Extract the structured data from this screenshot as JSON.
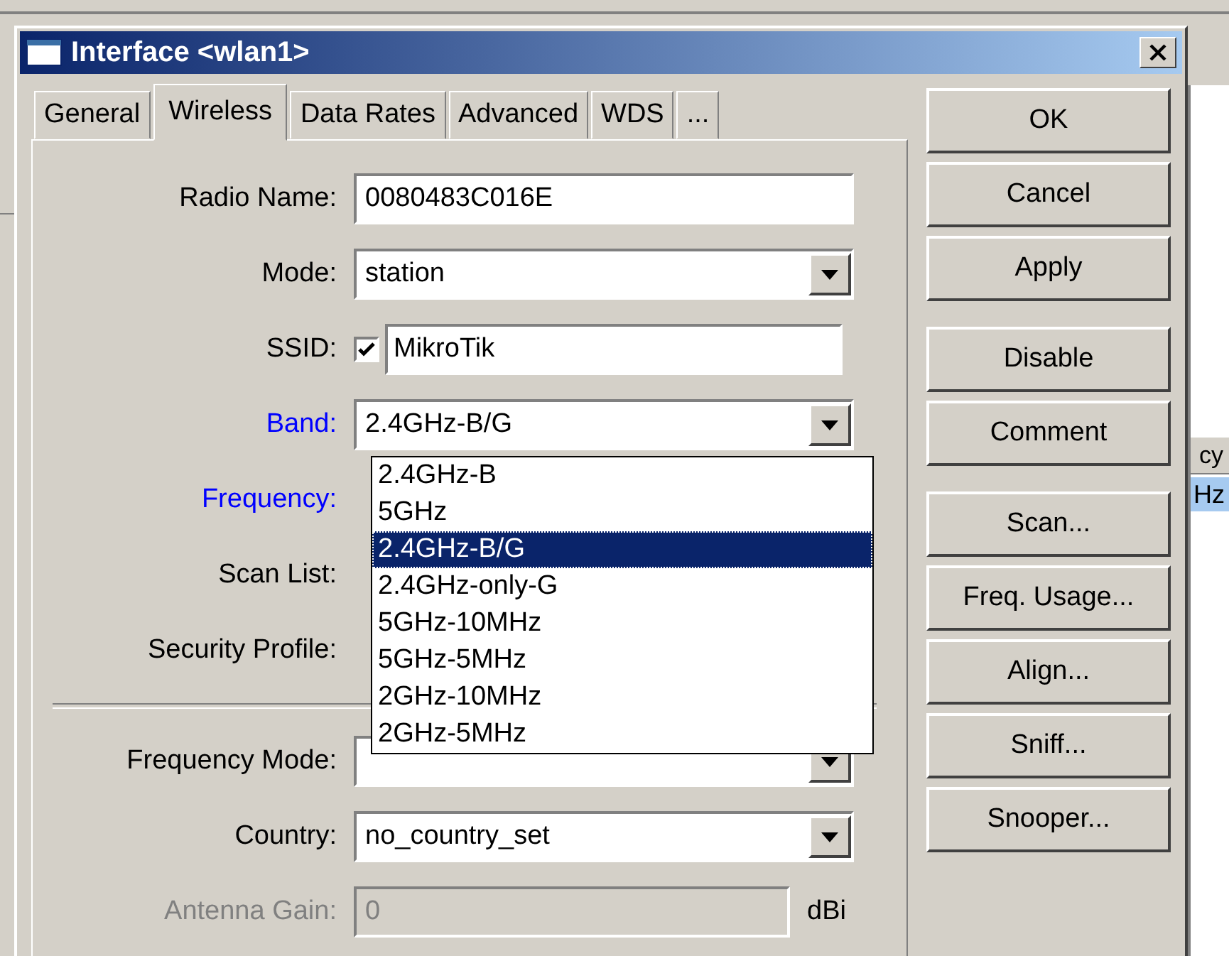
{
  "window": {
    "title": "Interface <wlan1>"
  },
  "tabs": [
    {
      "label": "General",
      "selected": false
    },
    {
      "label": "Wireless",
      "selected": true
    },
    {
      "label": "Data Rates",
      "selected": false
    },
    {
      "label": "Advanced",
      "selected": false
    },
    {
      "label": "WDS",
      "selected": false
    },
    {
      "label": "...",
      "selected": false
    }
  ],
  "fields": [
    {
      "kind": "text",
      "label": "Radio Name:",
      "value": "0080483C016E"
    },
    {
      "kind": "combo",
      "label": "Mode:",
      "value": "station"
    },
    {
      "kind": "checktext",
      "label": "SSID:",
      "checked": true,
      "value": "MikroTik"
    },
    {
      "kind": "combo",
      "label": "Band:",
      "value": "2.4GHz-B/G",
      "highlighted": true
    },
    {
      "kind": "covered",
      "label": "Frequency:",
      "highlighted": true
    },
    {
      "kind": "covered",
      "label": "Scan List:"
    },
    {
      "kind": "covered",
      "label": "Security Profile:"
    },
    {
      "kind": "separator"
    },
    {
      "kind": "combo",
      "label": "Frequency Mode:"
    },
    {
      "kind": "combo",
      "label": "Country:",
      "value": "no_country_set"
    },
    {
      "kind": "text",
      "label": "Antenna Gain:",
      "value": "0",
      "disabled": true,
      "unit": "dBi"
    }
  ],
  "band_dropdown": {
    "items": [
      {
        "label": "2.4GHz-B",
        "selected": false
      },
      {
        "label": "5GHz",
        "selected": false
      },
      {
        "label": "2.4GHz-B/G",
        "selected": true
      },
      {
        "label": "2.4GHz-only-G",
        "selected": false
      },
      {
        "label": "5GHz-10MHz",
        "selected": false
      },
      {
        "label": "5GHz-5MHz",
        "selected": false
      },
      {
        "label": "2GHz-10MHz",
        "selected": false
      },
      {
        "label": "2GHz-5MHz",
        "selected": false
      }
    ]
  },
  "button_groups": [
    [
      "OK",
      "Cancel",
      "Apply"
    ],
    [
      "Disable",
      "Comment"
    ],
    [
      "Scan...",
      "Freq. Usage...",
      "Align...",
      "Sniff...",
      "Snooper..."
    ]
  ],
  "background_window": {
    "column_header": "cy",
    "selected_cell": "Hz"
  }
}
